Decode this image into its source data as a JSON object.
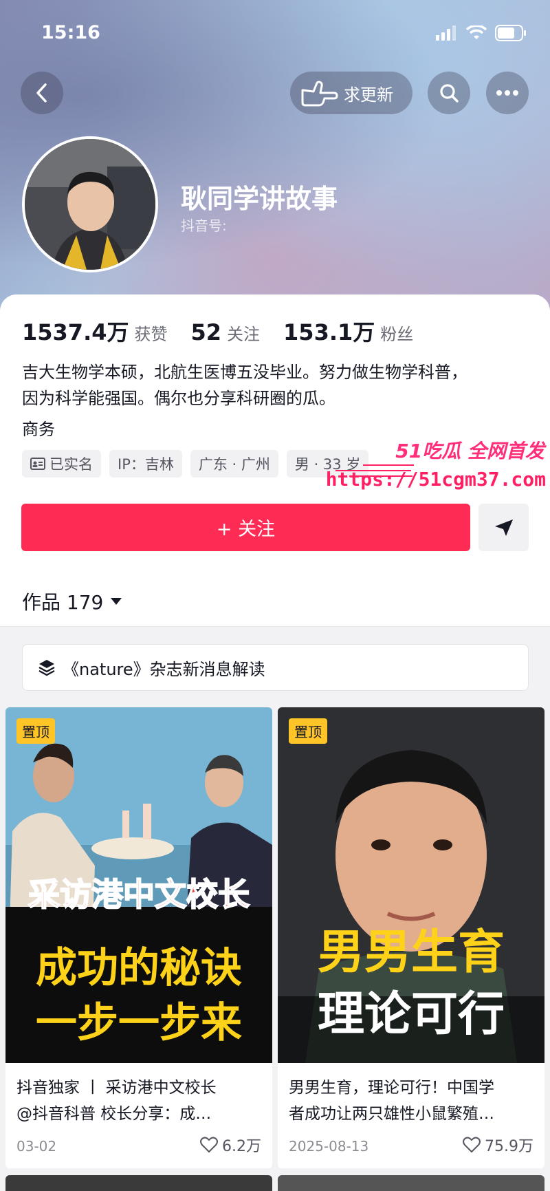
{
  "status": {
    "time": "15:16"
  },
  "header": {
    "request_update_label": "求更新"
  },
  "profile": {
    "name": "耿同学讲故事",
    "douyin_id_label": "抖音号:",
    "stats": [
      {
        "value": "1537.4万",
        "label": "获赞"
      },
      {
        "value": "52",
        "label": "关注"
      },
      {
        "value": "153.1万",
        "label": "粉丝"
      }
    ],
    "bio_line1": "吉大生物学本硕，北航生医博五没毕业。努力做生物学科普，",
    "bio_line2": "因为科学能强国。偶尔也分享科研圈的瓜。",
    "business_label": "商务",
    "tags": [
      {
        "icon": "id-card-icon",
        "label": "已实名"
      },
      {
        "label": "IP：吉林"
      },
      {
        "label": "广东 · 广州"
      },
      {
        "label": "男 · 33 岁"
      }
    ],
    "follow_label": "+ 关注"
  },
  "watermark": {
    "brand": "51吃瓜 全网首发",
    "url": "https://51cgm37.com"
  },
  "works": {
    "tab_label": "作品 179",
    "collection_label": "《nature》杂志新消息解读",
    "cards": [
      {
        "pin": "置顶",
        "thumb_line1": "采访港中文校长",
        "thumb_line2": "成功的秘诀",
        "thumb_line3": "一步一步来",
        "title_line1": "抖音独家 丨 采访港中文校长",
        "title_line2": "@抖音科普 校长分享：成…",
        "date": "03-02",
        "likes": "6.2万"
      },
      {
        "pin": "置顶",
        "thumb_line1": "男男生育",
        "thumb_line2": "理论可行",
        "title_line1": "男男生育，理论可行！中国学",
        "title_line2": "者成功让两只雄性小鼠繁殖…",
        "date": "2025-08-13",
        "likes": "75.9万"
      }
    ]
  },
  "colors": {
    "accent": "#fe2c55",
    "pin": "#ffc528",
    "watermark": "#ff1f63"
  }
}
